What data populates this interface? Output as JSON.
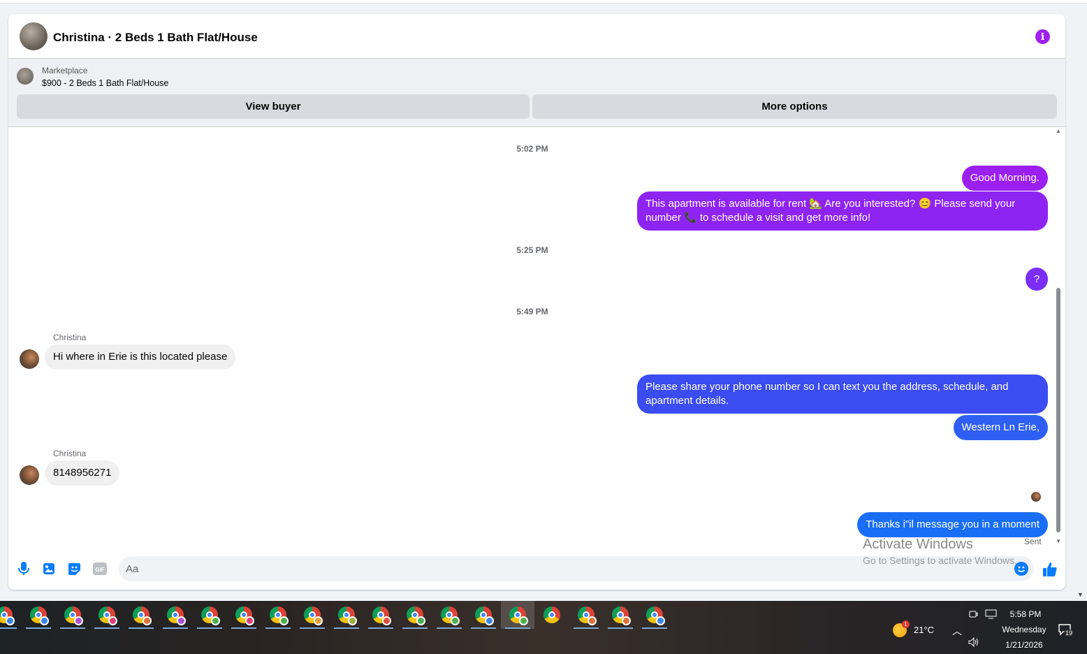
{
  "header": {
    "title": "Christina · 2 Beds 1 Bath Flat/House",
    "info_icon": "info-icon"
  },
  "marketplace": {
    "label": "Marketplace",
    "item": "$900 - 2 Beds 1 Bath Flat/House",
    "view_buyer": "View buyer",
    "more_options": "More options"
  },
  "messages": {
    "ts1": "5:02 PM",
    "m1": "Good Morning.",
    "m2": "This apartment is available for rent 🏡 Are you interested? 😊 Please send your number 📞 to schedule a visit and get more info!",
    "ts2": "5:25 PM",
    "m3": "?",
    "ts3": "5:49 PM",
    "sender1": "Christina",
    "m4": "Hi where in Erie is this located please",
    "m5": "Please share your phone number so I can text you the address, schedule, and apartment details.",
    "m6": "Western Ln Erie,",
    "sender2": "Christina",
    "m7": "8148956271",
    "m8": "Thanks i\"il message you in a moment",
    "status": "Sent"
  },
  "composer": {
    "placeholder": "Aa",
    "icons": [
      "microphone-icon",
      "photo-icon",
      "sticker-icon",
      "gif-icon",
      "emoji-icon",
      "thumbs-up-icon"
    ],
    "gif_label": "GIF"
  },
  "watermark": {
    "line1": "Activate Windows",
    "line2": "Go to Settings to activate Windows."
  },
  "taskbar": {
    "weather": "21°C",
    "time": "5:58 PM",
    "day": "Wednesday",
    "date": "1/21/2026",
    "notifications": "19",
    "weather_badge": "1"
  },
  "colors": {
    "purple": "#9b1ff0",
    "violet": "#7a2ef5",
    "indigo": "#3b4cf0",
    "blue": "#1a6ef5",
    "accent": "#0a7cff"
  }
}
